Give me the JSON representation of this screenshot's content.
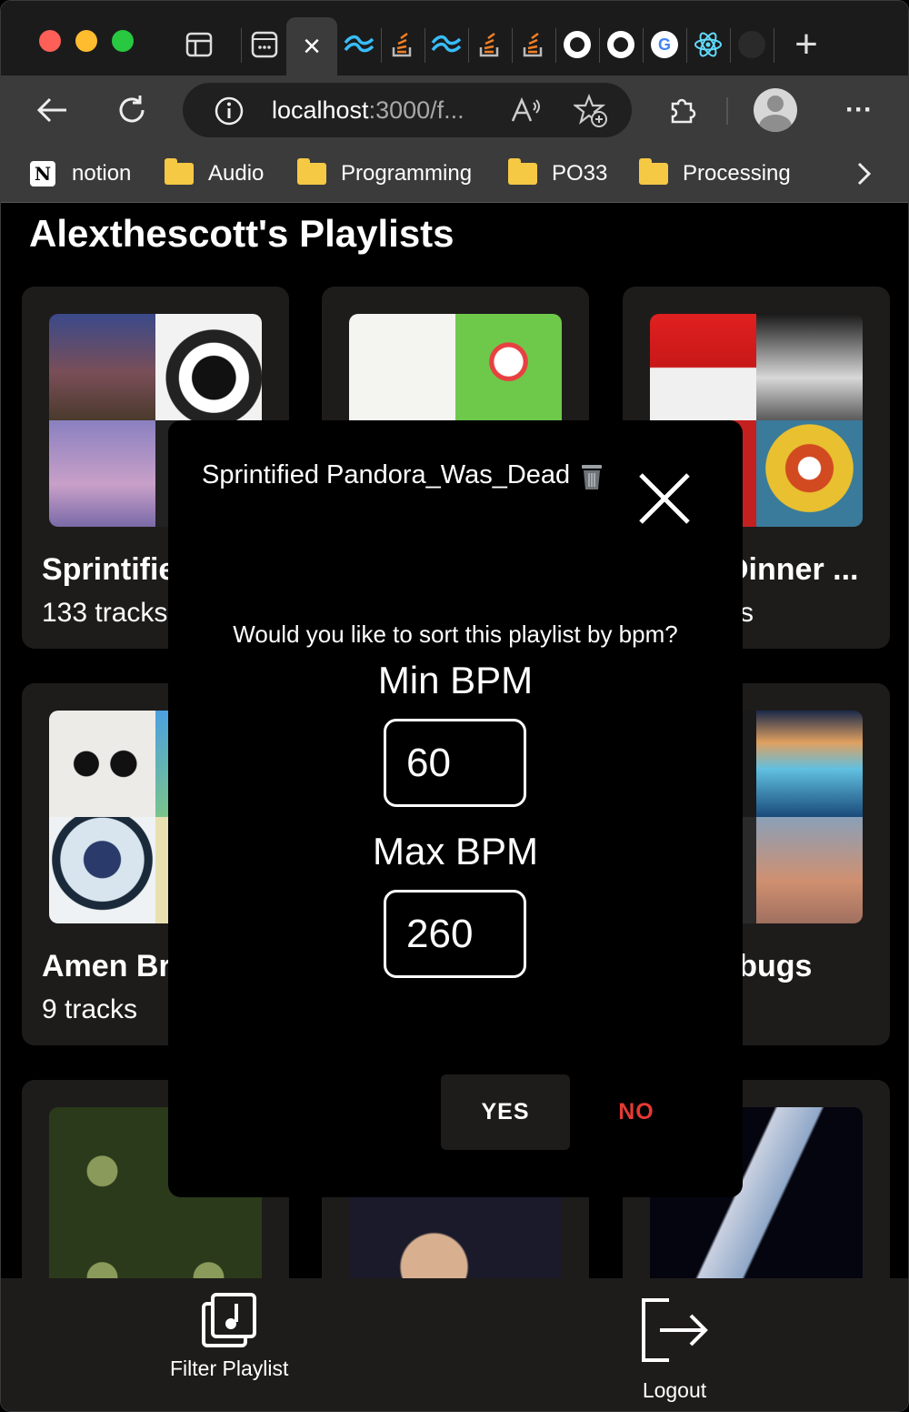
{
  "browser": {
    "tabs": {
      "sidebar_icon": "sidebar-icon",
      "active_tab_close": "×",
      "new_tab_label": "+"
    },
    "url": {
      "host": "localhost",
      "rest": ":3000/f..."
    },
    "bookmarks": [
      {
        "label": "notion",
        "icon": "notion-icon"
      },
      {
        "label": "Audio",
        "icon": "folder-icon"
      },
      {
        "label": "Programming",
        "icon": "folder-icon"
      },
      {
        "label": "PO33",
        "icon": "folder-icon"
      },
      {
        "label": "Processing",
        "icon": "folder-icon"
      }
    ],
    "menu_label": "···"
  },
  "page": {
    "title": "Alexthescott's Playlists",
    "playlists": [
      {
        "name": "Sprintifie",
        "count": "133 tracks"
      },
      {
        "name": "",
        "count": ""
      },
      {
        "name": "Dinner ...",
        "count": "ks"
      },
      {
        "name": "Amen Br",
        "count": "9 tracks"
      },
      {
        "name": "",
        "count": ""
      },
      {
        "name": "rbugs",
        "count": ""
      }
    ]
  },
  "bottom_bar": {
    "filter_label": "Filter Playlist",
    "logout_label": "Logout"
  },
  "modal": {
    "title": "Sprintified Pandora_Was_Dead",
    "prompt": "Would you like to sort this playlist by bpm?",
    "min_label": "Min BPM",
    "min_value": "60",
    "max_label": "Max BPM",
    "max_value": "260",
    "yes_label": "YES",
    "no_label": "NO"
  },
  "colors": {
    "accent_no": "#e53935",
    "card_bg": "#1e1c1b",
    "folder": "#f6c945"
  }
}
